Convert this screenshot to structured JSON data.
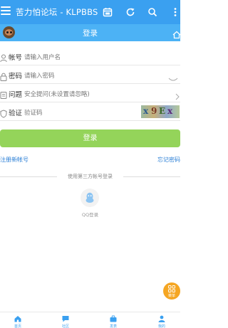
{
  "appbar": {
    "title": "苦力怕论坛 - KLPBBS",
    "icons": [
      "menu-icon",
      "calendar-icon",
      "refresh-icon",
      "search-icon",
      "more-icon"
    ]
  },
  "subbar": {
    "heading": "登录",
    "icons": [
      "avatar",
      "home-icon"
    ]
  },
  "form": {
    "account_label": "帐号",
    "account_placeholder": "请输入用户名",
    "password_label": "密码",
    "password_placeholder": "请输入密码",
    "question_label": "问题",
    "question_value": "安全提问(未设置请忽略)",
    "captcha_label": "验证",
    "captcha_placeholder": "验证码"
  },
  "actions": {
    "login": "登录",
    "register": "注册新帐号",
    "forgot": "忘记密码"
  },
  "third_party": {
    "divider": "使用第三方帐号登录",
    "qq_label": "QQ登录"
  },
  "fab": {
    "label": "菜单"
  },
  "tabs": [
    {
      "label": "首页",
      "icon": "home-icon"
    },
    {
      "label": "社区",
      "icon": "chat-icon"
    },
    {
      "label": "发表",
      "icon": "briefcase-icon"
    },
    {
      "label": "我的",
      "icon": "user-icon"
    }
  ],
  "colors": {
    "primary": "#3aa0f0",
    "subbar": "#4cb2f5",
    "login_button": "#94d45a",
    "link": "#2b7fd6",
    "fab": "#f5a623"
  }
}
